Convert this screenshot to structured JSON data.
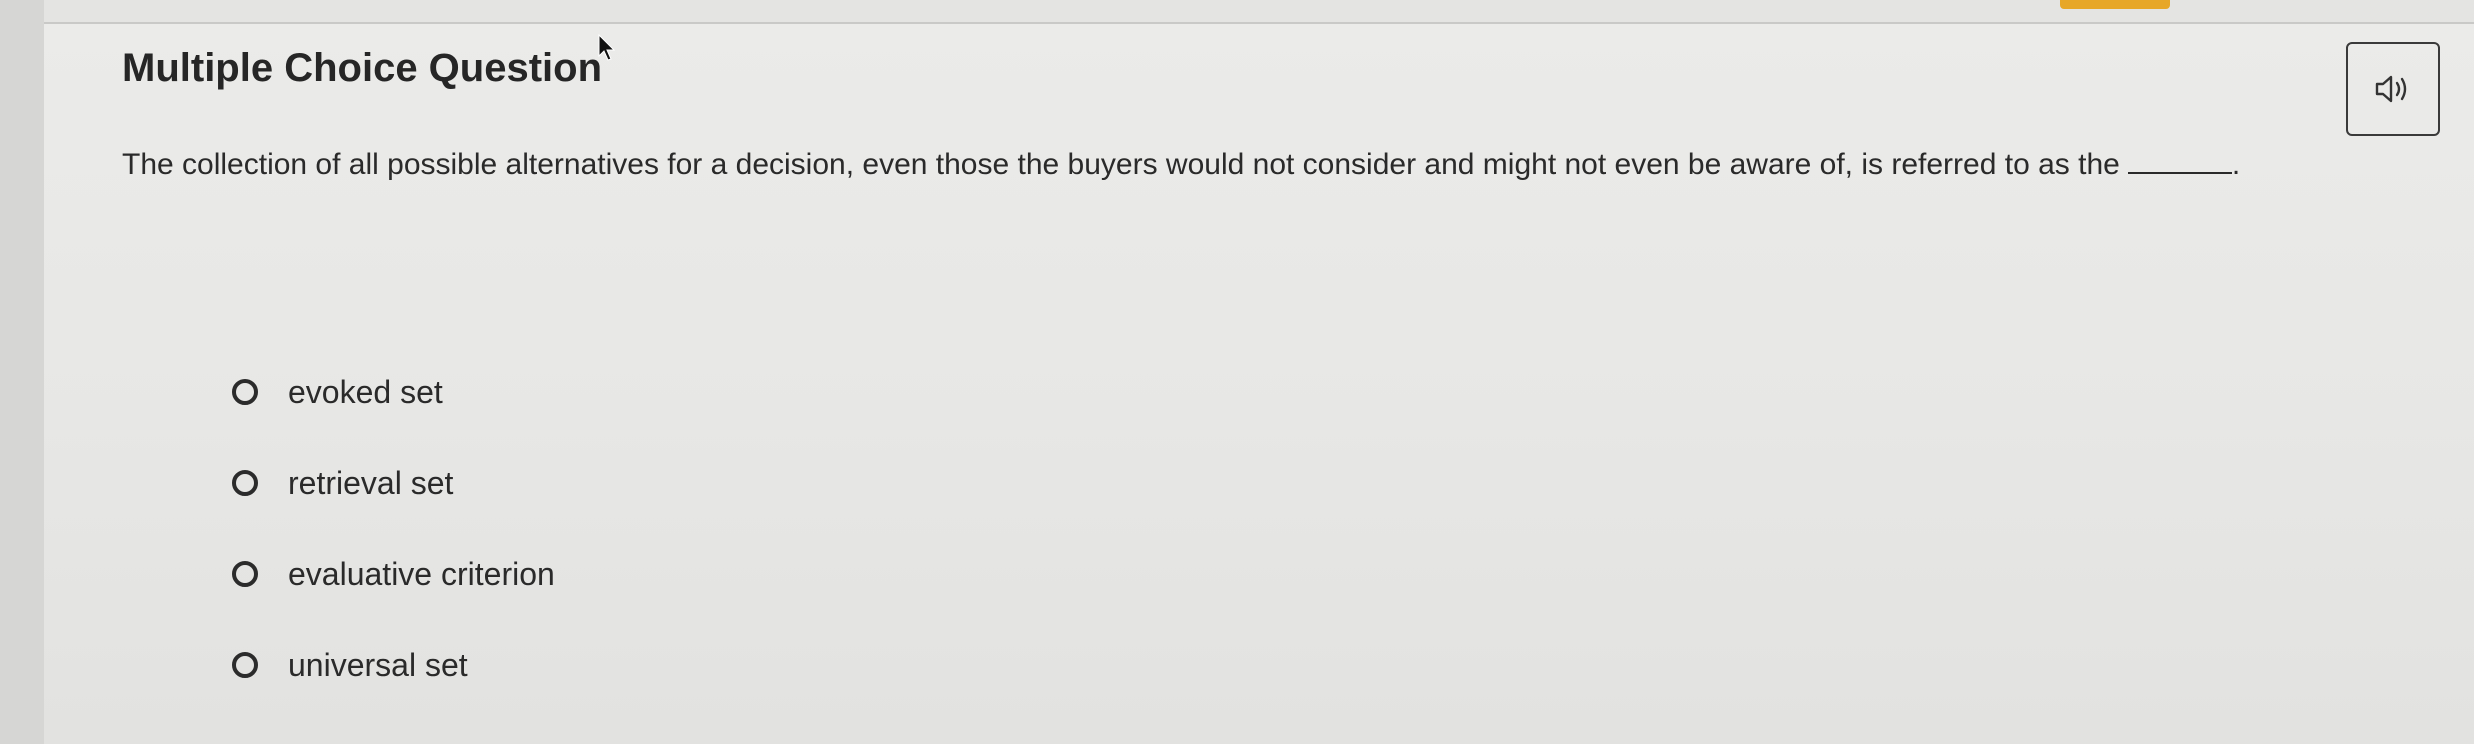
{
  "question": {
    "heading": "Multiple Choice Question",
    "prompt": "The collection of all possible alternatives for a decision, even those the buyers would not consider and might not even be aware of, is referred to as the",
    "prompt_end": "."
  },
  "toolbar": {
    "audio_icon": "speaker-icon"
  },
  "options": [
    {
      "label": "evoked set"
    },
    {
      "label": "retrieval set"
    },
    {
      "label": "evaluative criterion"
    },
    {
      "label": "universal set"
    }
  ],
  "colors": {
    "accent_tab": "#e7a728",
    "text": "#2a2a2a",
    "background": "#e8e8e6"
  }
}
